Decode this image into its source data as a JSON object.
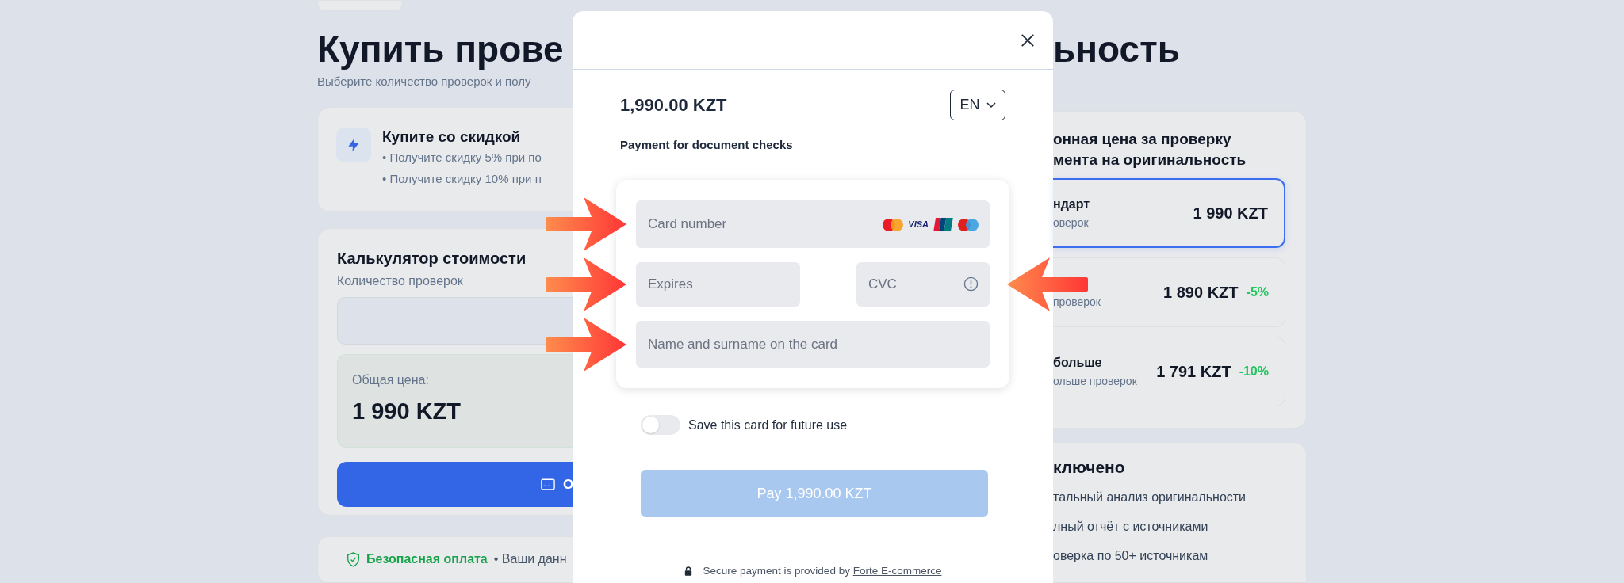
{
  "page": {
    "title_left": "Купить прове",
    "title_right": "ьность",
    "subtitle": "Выберите количество проверок и полу"
  },
  "discount_card": {
    "title": "Купите со скидкой",
    "bullets": [
      "• Получите скидку 5% при по",
      "• Получите скидку 10% при п"
    ]
  },
  "calculator": {
    "title": "Калькулятор стоимости",
    "quantity_label": "Количество проверок",
    "total_label": "Общая цена:",
    "total": "1 990 KZT",
    "button_label": "О"
  },
  "security_bar": {
    "title": "Безопасная оплата",
    "text": "• Ваши данн"
  },
  "pricing": {
    "title_lines": [
      "онная цена за проверку",
      "мента на оригинальность"
    ],
    "options": [
      {
        "name": "ндарт",
        "subtitle": "оверок",
        "price": "1 990 KZT",
        "selected": true
      },
      {
        "subtitle": "проверок",
        "price": "1 890 KZT",
        "discount": "-5%",
        "selected": false
      },
      {
        "name": "больше",
        "subtitle": "ольше проверок",
        "price": "1 791 KZT",
        "discount": "-10%",
        "selected": false
      }
    ]
  },
  "included": {
    "title": "ключено",
    "items": [
      "тальный анализ оригинальности",
      "лный отчёт с источниками",
      "оверка по 50+ источникам"
    ]
  },
  "payment_modal": {
    "amount": "1,990.00 KZT",
    "language": "EN",
    "description": "Payment for document checks",
    "card_number": {
      "placeholder": "Card number",
      "visa_logo": "VISA"
    },
    "expires": {
      "placeholder": "Expires"
    },
    "cvc": {
      "placeholder": "CVC"
    },
    "cardholder": {
      "placeholder": "Name and surname on the card"
    },
    "save_card": {
      "label": "Save this card for future use",
      "on": false
    },
    "pay_button": {
      "label": "Pay 1,990.00 KZT",
      "disabled": true
    },
    "footer": {
      "text": "Secure payment is provided by",
      "link": "Forte E-commerce"
    }
  },
  "annotations": [
    {
      "kind": "arrow-right"
    },
    {
      "kind": "arrow-right"
    },
    {
      "kind": "arrow-right"
    },
    {
      "kind": "arrow-left"
    }
  ]
}
